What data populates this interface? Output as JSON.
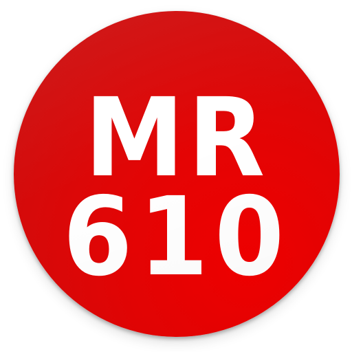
{
  "app_icon": {
    "line1": "MR",
    "line2": "610",
    "colors": {
      "background": "#e00505",
      "text": "#ffffff",
      "page": "#ffffff"
    }
  }
}
